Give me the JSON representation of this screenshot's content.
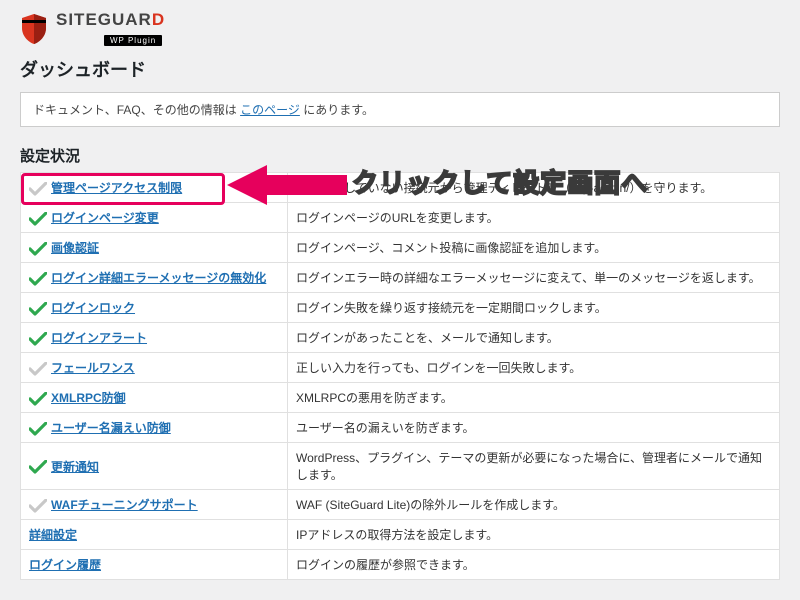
{
  "brand": {
    "name_prefix": "SITEGUAR",
    "name_accent": "D",
    "sub": "WP Plugin"
  },
  "dashboard_title": "ダッシュボード",
  "notice": {
    "before": "ドキュメント、FAQ、その他の情報は ",
    "link": "このページ",
    "after": " にあります。"
  },
  "section_title": "設定状況",
  "rows": [
    {
      "enabled": false,
      "label": "管理ページアクセス制限",
      "desc": "ログインしていない接続元から管理ディレクトリ（/wp-admin/）を守ります。"
    },
    {
      "enabled": true,
      "label": "ログインページ変更",
      "desc": "ログインページのURLを変更します。"
    },
    {
      "enabled": true,
      "label": "画像認証",
      "desc": "ログインページ、コメント投稿に画像認証を追加します。"
    },
    {
      "enabled": true,
      "label": "ログイン詳細エラーメッセージの無効化",
      "desc": "ログインエラー時の詳細なエラーメッセージに変えて、単一のメッセージを返します。"
    },
    {
      "enabled": true,
      "label": "ログインロック",
      "desc": "ログイン失敗を繰り返す接続元を一定期間ロックします。"
    },
    {
      "enabled": true,
      "label": "ログインアラート",
      "desc": "ログインがあったことを、メールで通知します。"
    },
    {
      "enabled": false,
      "label": "フェールワンス",
      "desc": "正しい入力を行っても、ログインを一回失敗します。"
    },
    {
      "enabled": true,
      "label": "XMLRPC防御",
      "desc": "XMLRPCの悪用を防ぎます。"
    },
    {
      "enabled": true,
      "label": "ユーザー名漏えい防御",
      "desc": "ユーザー名の漏えいを防ぎます。"
    },
    {
      "enabled": true,
      "label": "更新通知",
      "desc": "WordPress、プラグイン、テーマの更新が必要になった場合に、管理者にメールで通知します。"
    },
    {
      "enabled": false,
      "label": "WAFチューニングサポート",
      "desc": "WAF (SiteGuard Lite)の除外ルールを作成します。"
    },
    {
      "enabled": null,
      "label": "詳細設定",
      "desc": "IPアドレスの取得方法を設定します。"
    },
    {
      "enabled": null,
      "label": "ログイン履歴",
      "desc": "ログインの履歴が参照できます。"
    }
  ],
  "callout_text": "クリックして設定画面へ",
  "colors": {
    "link": "#1f6fb2",
    "enabled": "#2fa84f",
    "disabled": "#c8c8c8",
    "highlight": "#e6005c",
    "arrow": "#e6005c",
    "brand_accent": "#d9341f"
  }
}
